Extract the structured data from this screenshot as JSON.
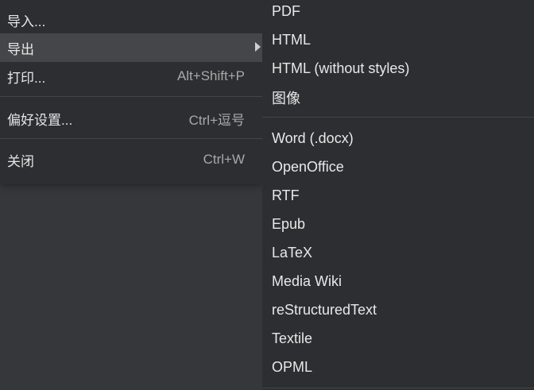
{
  "file_menu": {
    "items": [
      {
        "label": "导入...",
        "shortcut": ""
      },
      {
        "label": "导出",
        "shortcut": ""
      },
      {
        "label": "打印...",
        "shortcut": "Alt+Shift+P"
      },
      {
        "label": "偏好设置...",
        "shortcut": "Ctrl+逗号"
      },
      {
        "label": "关闭",
        "shortcut": "Ctrl+W"
      }
    ],
    "active_item": "导出"
  },
  "export_submenu": {
    "group1": [
      {
        "label": "PDF"
      },
      {
        "label": "HTML"
      },
      {
        "label": "HTML (without styles)"
      },
      {
        "label": "图像"
      }
    ],
    "group2": [
      {
        "label": "Word (.docx)"
      },
      {
        "label": "OpenOffice"
      },
      {
        "label": "RTF"
      },
      {
        "label": "Epub"
      },
      {
        "label": "LaTeX"
      },
      {
        "label": "Media Wiki"
      },
      {
        "label": "reStructuredText"
      },
      {
        "label": "Textile"
      },
      {
        "label": "OPML"
      }
    ]
  },
  "icons": {
    "submenu_arrow": "chevron-right-icon"
  },
  "colors": {
    "menu_bg": "#2d2e31",
    "active_bg": "#45464a",
    "page_bg": "#36373a",
    "text": "#e6e6e6",
    "shortcut_text": "#a8a8a8"
  }
}
